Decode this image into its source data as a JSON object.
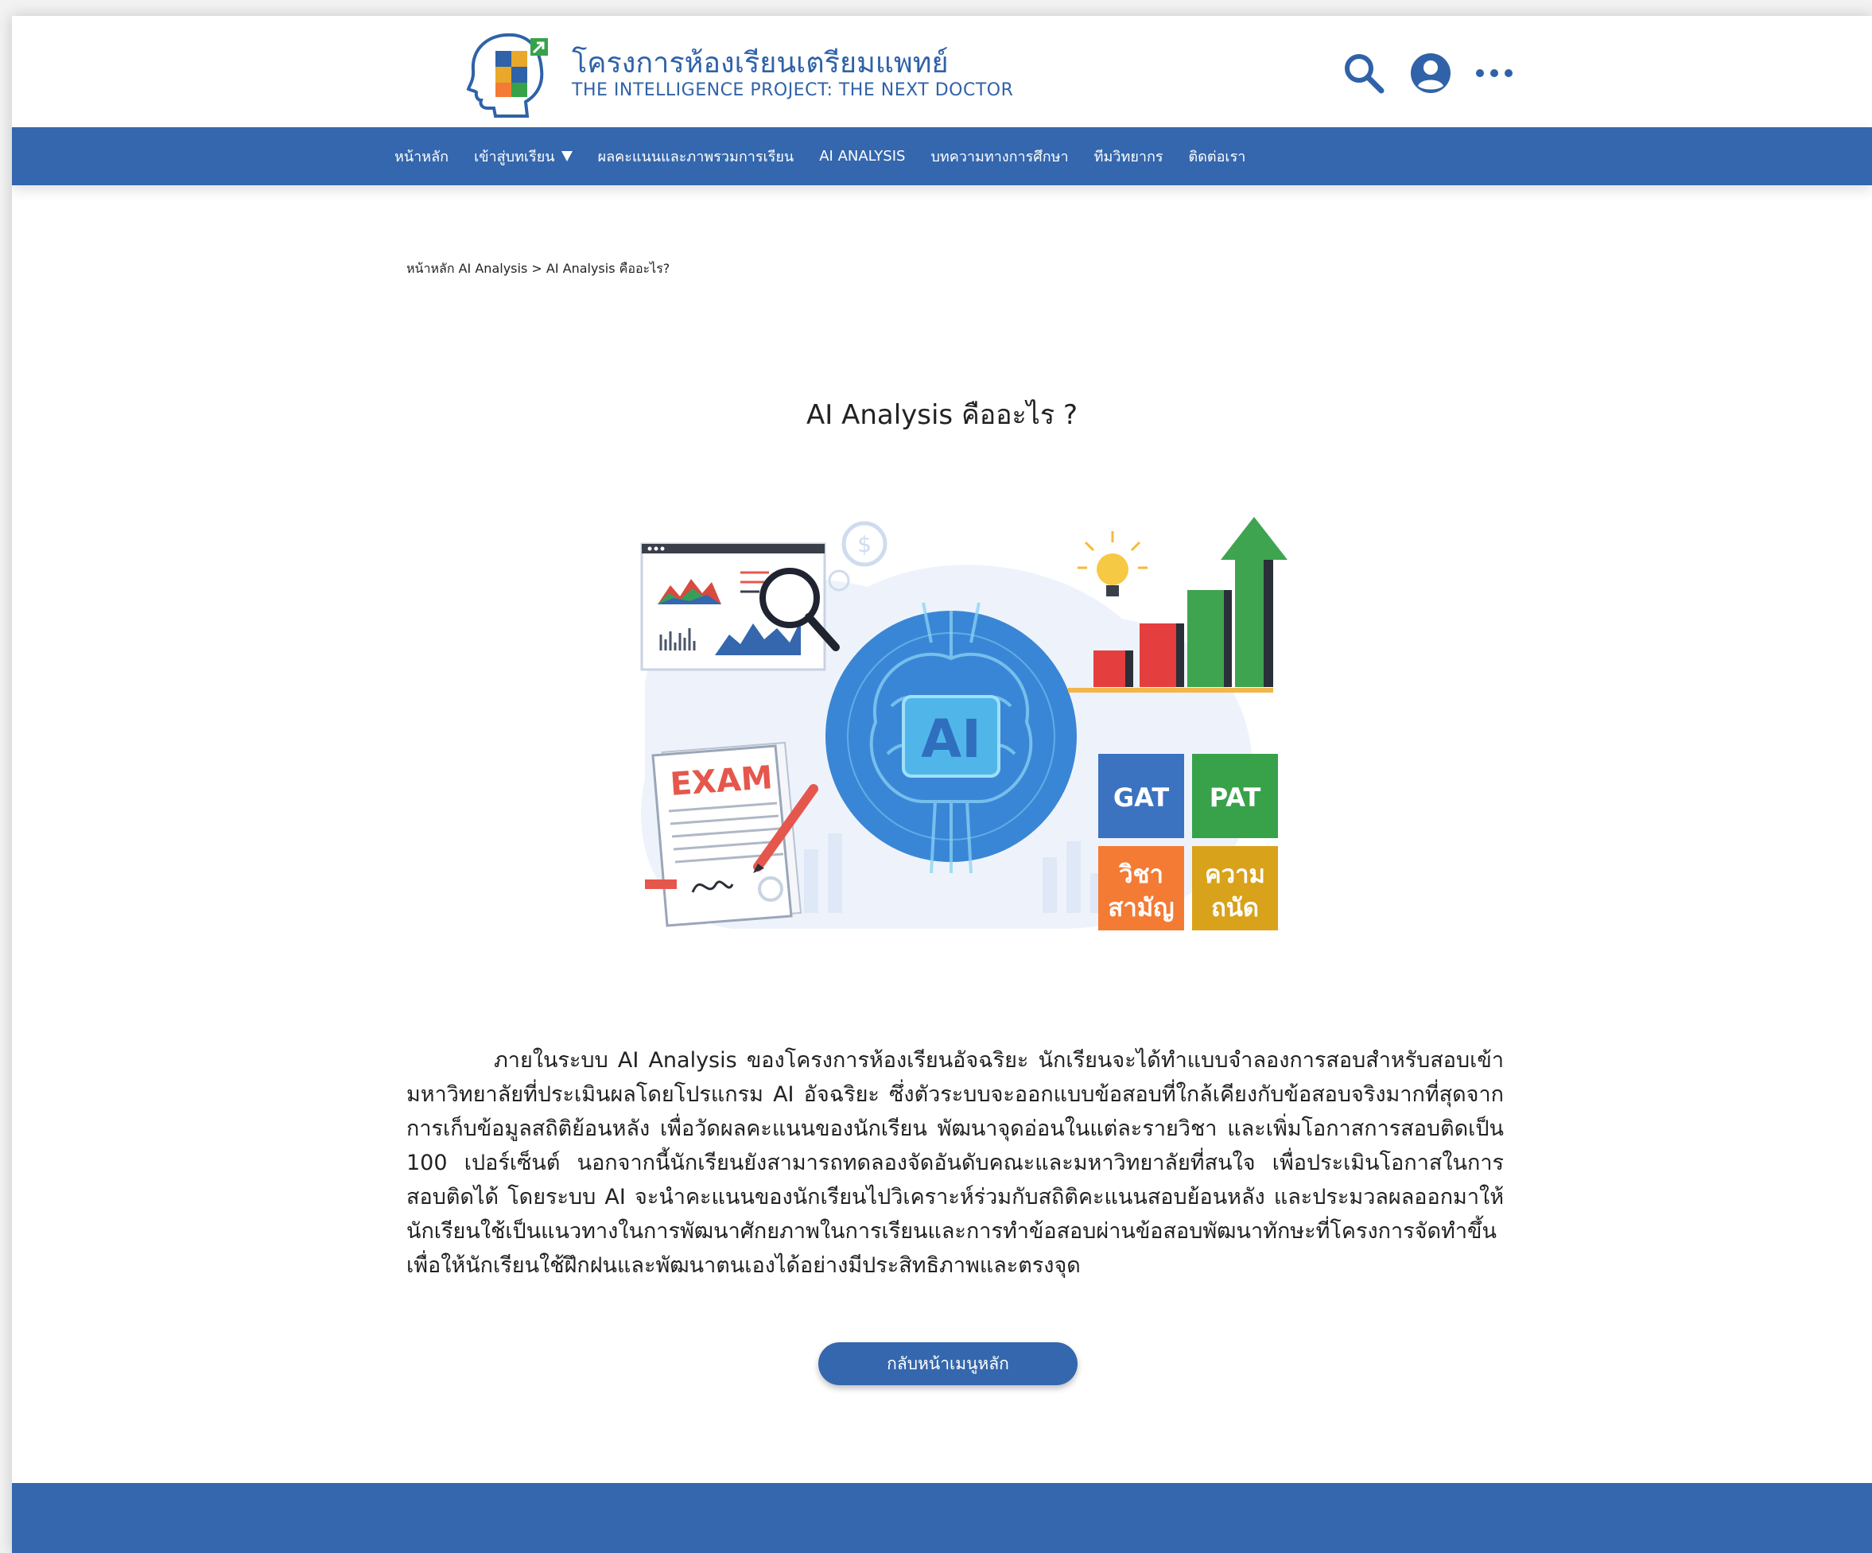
{
  "header": {
    "brand_th": "โครงการห้องเรียนเตรียมแพทย์",
    "brand_en": "THE INTELLIGENCE PROJECT: THE NEXT DOCTOR",
    "icons": [
      "search-icon",
      "user-account-icon",
      "more-icon"
    ]
  },
  "nav": {
    "items": [
      {
        "label": "หน้าหลัก"
      },
      {
        "label": "เข้าสู่บทเรียน",
        "has_dropdown": true
      },
      {
        "label": "ผลคะแนนและภาพรวมการเรียน"
      },
      {
        "label": "AI ANALYSIS"
      },
      {
        "label": "บทความทางการศึกษา"
      },
      {
        "label": "ทีมวิทยากร"
      },
      {
        "label": "ติดต่อเรา"
      }
    ]
  },
  "breadcrumb": {
    "home": "หน้าหลัก",
    "section": "AI Analysis",
    "separator": ">",
    "current": "AI Analysis คืออะไร?"
  },
  "title": "AI Analysis คืออะไร ?",
  "illustration": {
    "exam_label": "EXAM",
    "ai_label": "AI",
    "tiles": [
      "GAT",
      "PAT",
      "วิชา",
      "สามัญ",
      "ความ",
      "ถนัด"
    ]
  },
  "content": {
    "paragraph": "ภายในระบบ AI Analysis ของโครงการห้องเรียนอัจฉริยะ นักเรียนจะได้ทำแบบจำลองการสอบสำหรับสอบเข้ามหาวิทยาลัยที่ประเมินผลโดยโปรแกรม AI อัจฉริยะ ซึ่งตัวระบบจะออกแบบข้อสอบที่ใกล้เคียงกับข้อสอบจริงมากที่สุดจากการเก็บข้อมูลสถิติย้อนหลัง เพื่อวัดผลคะแนนของนักเรียน พัฒนาจุดอ่อนในแต่ละรายวิชา และเพิ่มโอกาสการสอบติดเป็น 100 เปอร์เซ็นต์ นอกจากนี้นักเรียนยังสามารถทดลองจัดอันดับคณะและมหาวิทยาลัยที่สนใจ เพื่อประเมินโอกาสในการสอบติดได้ โดยระบบ AI จะนำคะแนนของนักเรียนไปวิเคราะห์ร่วมกับสถิติคะแนนสอบย้อนหลัง และประมวลผลออกมาให้นักเรียนใช้เป็นแนวทางในการพัฒนาศักยภาพในการเรียนและการทำข้อสอบผ่านข้อสอบพัฒนาทักษะที่โครงการจัดทำขึ้น เพื่อให้นักเรียนใช้ฝึกฝนและพัฒนาตนเองได้อย่างมีประสิทธิภาพและตรงจุด"
  },
  "back_button": "กลับหน้าเมนูหลัก",
  "colors": {
    "primary": "#3467ad",
    "brand_text": "#2f62a8",
    "gat": "#3b73c1",
    "pat": "#38a24a",
    "subject": "#f47b34",
    "aptitude": "#d9a21b"
  }
}
